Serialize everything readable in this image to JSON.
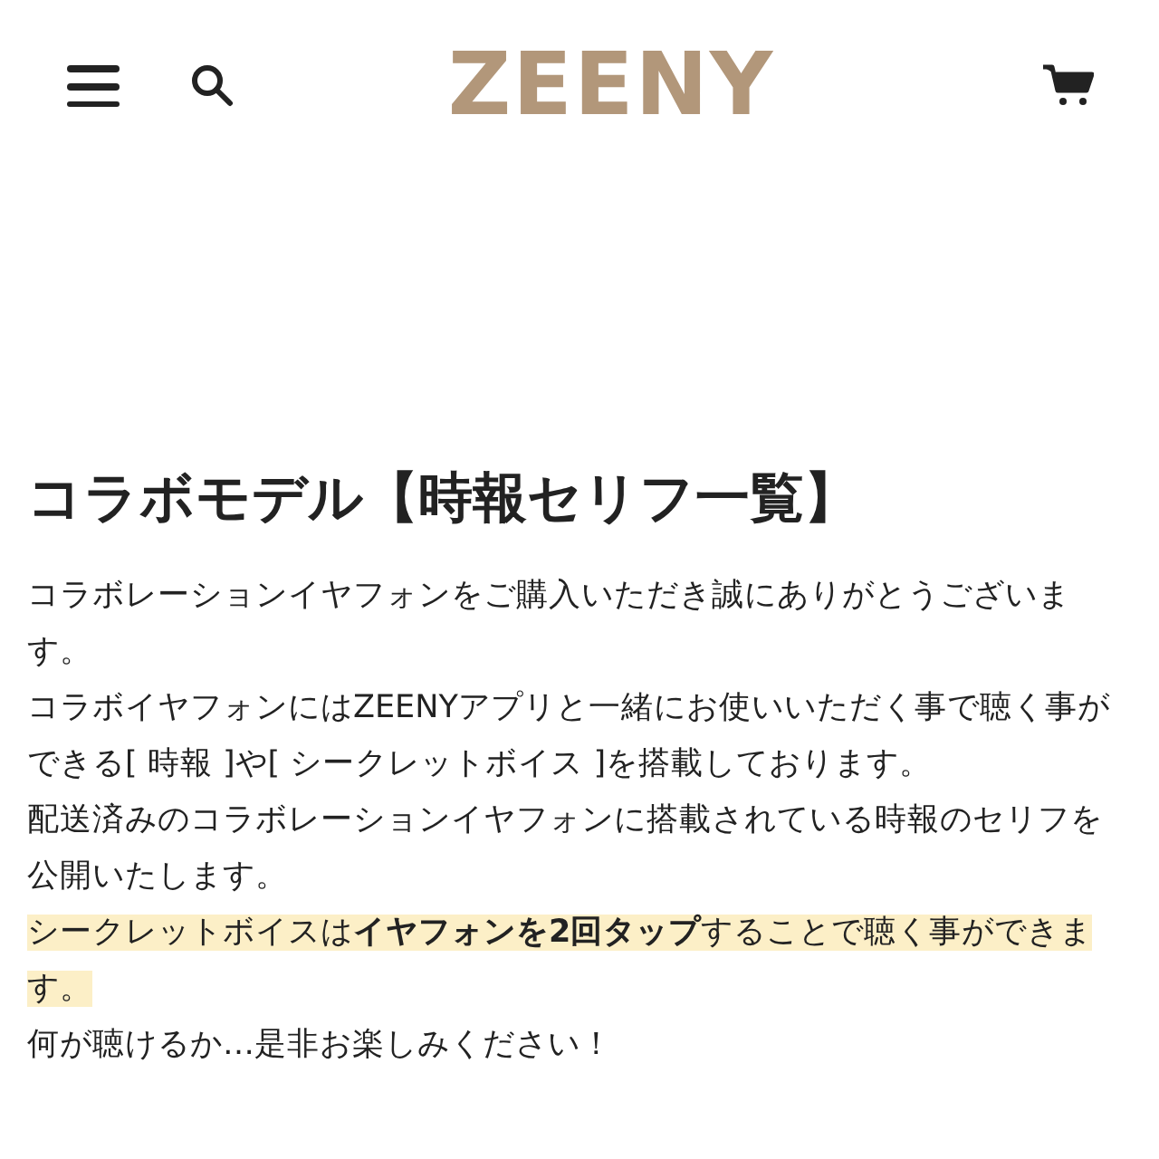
{
  "header": {
    "logo": "ZEENY"
  },
  "article": {
    "title": "コラボモデル【時報セリフ一覧】",
    "paragraphs": [
      {
        "text": "コラボレーションイヤフォンをご購入いただき誠にありがとうございます。",
        "highlighted": false
      },
      {
        "text": "コラボイヤフォンにはZEENYアプリと一緒にお使いいただく事で聴く事ができる[ 時報 ]や[ シークレットボイス ]を搭載しております。",
        "highlighted": false
      },
      {
        "text": "配送済みのコラボレーションイヤフォンに搭載されている時報のセリフを公開いたします。",
        "highlighted": false
      },
      {
        "text": "シークレットボイスは**イヤフォンを2回タップ**することで聴く事ができます。",
        "highlighted": true
      },
      {
        "text": "何が聴けるか…是非お楽しみください！",
        "highlighted": false
      }
    ]
  }
}
